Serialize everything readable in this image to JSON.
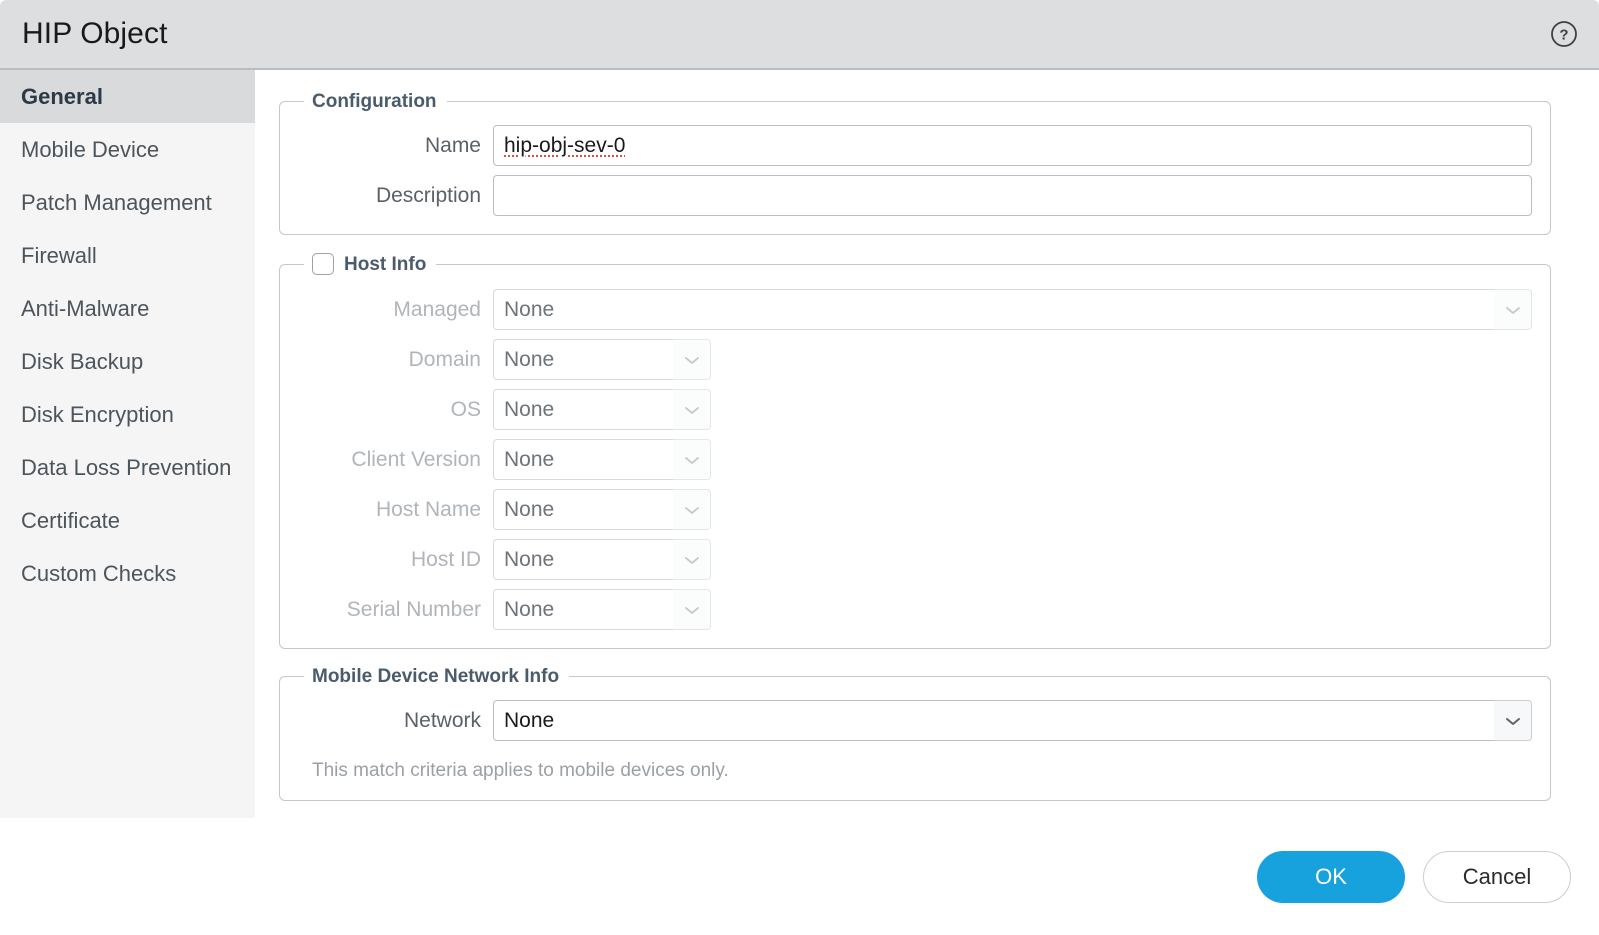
{
  "window": {
    "title": "HIP Object",
    "help_icon": "help-circle-icon"
  },
  "sidebar": {
    "items": [
      {
        "label": "General",
        "selected": true
      },
      {
        "label": "Mobile Device",
        "selected": false
      },
      {
        "label": "Patch Management",
        "selected": false
      },
      {
        "label": "Firewall",
        "selected": false
      },
      {
        "label": "Anti-Malware",
        "selected": false
      },
      {
        "label": "Disk Backup",
        "selected": false
      },
      {
        "label": "Disk Encryption",
        "selected": false
      },
      {
        "label": "Data Loss Prevention",
        "selected": false
      },
      {
        "label": "Certificate",
        "selected": false
      },
      {
        "label": "Custom Checks",
        "selected": false
      }
    ]
  },
  "configuration": {
    "legend": "Configuration",
    "name_label": "Name",
    "name_value": "hip-obj-sev-0",
    "description_label": "Description",
    "description_value": ""
  },
  "host_info": {
    "legend": "Host Info",
    "checked": false,
    "fields": [
      {
        "label": "Managed",
        "value": "None",
        "width": "full",
        "arrow": false
      },
      {
        "label": "Domain",
        "value": "None",
        "width": "short",
        "arrow": true
      },
      {
        "label": "OS",
        "value": "None",
        "width": "short",
        "arrow": true
      },
      {
        "label": "Client Version",
        "value": "None",
        "width": "short",
        "arrow": true
      },
      {
        "label": "Host Name",
        "value": "None",
        "width": "short",
        "arrow": true
      },
      {
        "label": "Host ID",
        "value": "None",
        "width": "short",
        "arrow": true
      },
      {
        "label": "Serial Number",
        "value": "None",
        "width": "short",
        "arrow": true
      }
    ]
  },
  "mobile_device_network_info": {
    "legend": "Mobile Device Network Info",
    "network_label": "Network",
    "network_value": "None",
    "note": "This match criteria applies to mobile devices only."
  },
  "footer": {
    "ok_label": "OK",
    "cancel_label": "Cancel"
  },
  "colors": {
    "accent": "#17a2dd",
    "legend_text": "#4a5b6b",
    "titlebar_bg": "#dcdee0",
    "sidebar_bg": "#f5f5f5",
    "sidebar_selected_bg": "#d8dadc",
    "spellcheck_underline": "#e04a43"
  }
}
